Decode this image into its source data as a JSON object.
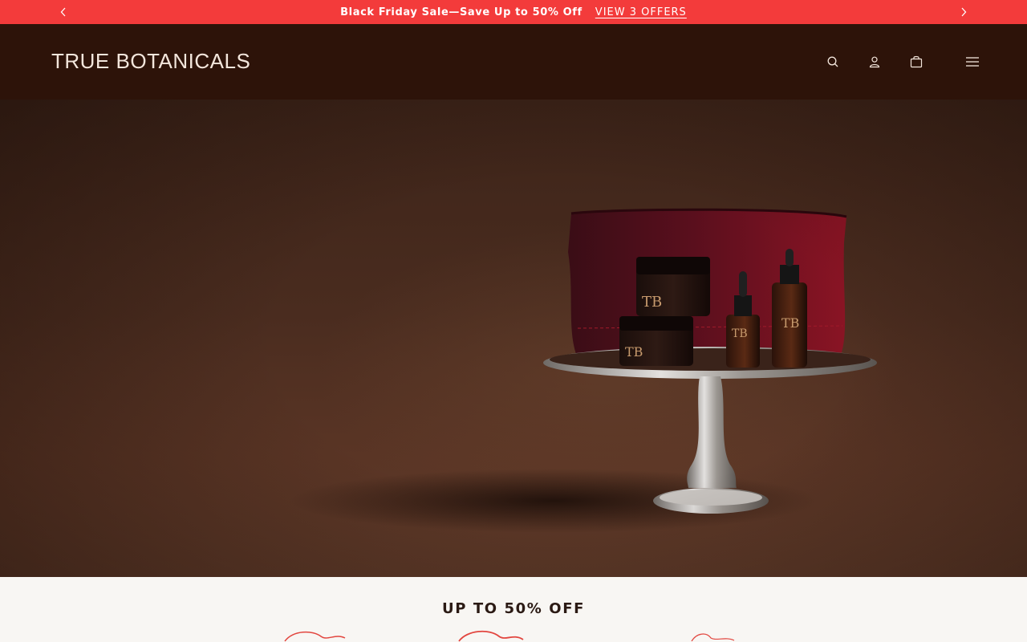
{
  "announcement": {
    "message": "Black Friday Sale—Save Up to 50% Off",
    "offers_link": "VIEW 3 OFFERS",
    "prev_icon": "chevron-left-icon",
    "next_icon": "chevron-right-icon"
  },
  "header": {
    "logo": "TRUE BOTANICALS",
    "icons": [
      "search-icon",
      "account-icon",
      "bag-icon",
      "menu-icon"
    ]
  },
  "hero": {
    "image": "skincare-gift-set-on-silver-cake-stand"
  },
  "offers_section": {
    "title": "UP TO 50% OFF"
  },
  "colors": {
    "announcement_bg": "#f33b3b",
    "header_bg": "#2d1309",
    "logo": "#f3e6dc",
    "hero_bg": "#4a2c1f",
    "page_bg": "#f8f6f3",
    "accent_red": "#e2463f"
  }
}
